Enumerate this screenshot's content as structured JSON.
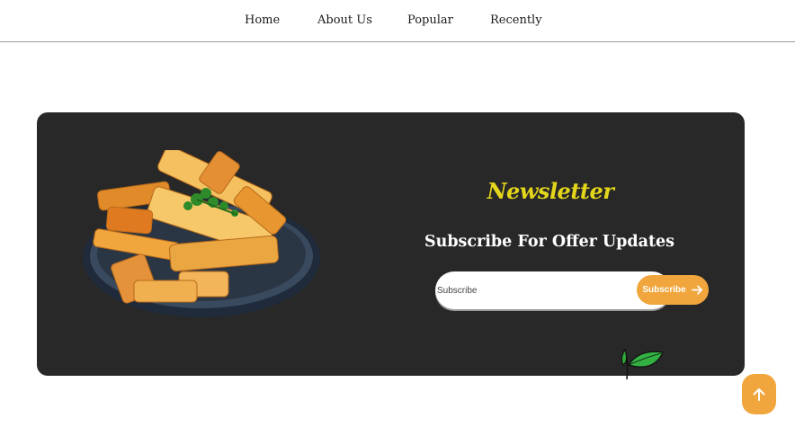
{
  "nav": {
    "items": [
      {
        "label": "Home"
      },
      {
        "label": "About Us"
      },
      {
        "label": "Popular"
      },
      {
        "label": "Recently"
      }
    ]
  },
  "newsletter": {
    "script_title": "Newsletter",
    "heading": "Subscribe For Offer Updates",
    "input_placeholder": "Subscribe",
    "button_label": "Subscribe"
  },
  "colors": {
    "card_background": "#282828",
    "accent_yellow": "#e3d51a",
    "accent_orange": "#f0a63d"
  },
  "icons": {
    "button_icon": "arrow-right-icon",
    "scroll_top_icon": "arrow-up-icon",
    "decoration": "leaf-icon"
  }
}
